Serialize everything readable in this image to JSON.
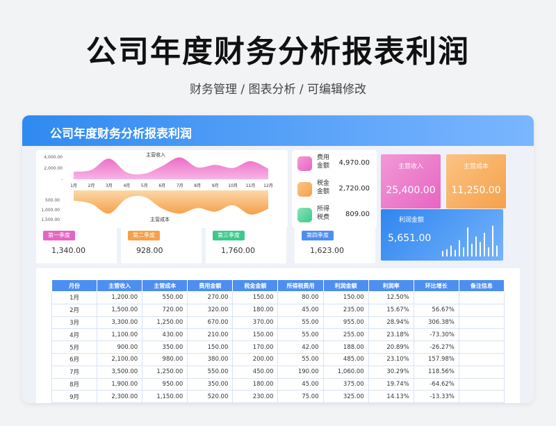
{
  "header": {
    "title": "公司年度财务分析报表利润",
    "subtitle": "财务管理 / 图表分析 /  可编辑修改"
  },
  "card": {
    "title": "公司年度财务分析报表利润"
  },
  "colors": {
    "income": "#e765c2",
    "cost": "#f5a14a",
    "header_blue": "#2f8af0",
    "table_header": "#4d8ff0"
  },
  "chart_data": {
    "type": "area",
    "top_chart": {
      "title": "主营收入",
      "y_ticks": [
        "4,000.00",
        "2,000.00",
        "-"
      ],
      "ylim": [
        0,
        4000
      ],
      "x": [
        "1月",
        "2月",
        "3月",
        "4月",
        "5月",
        "6月",
        "7月",
        "8月",
        "9月",
        "10月",
        "11月",
        "12月"
      ],
      "series": [
        {
          "name": "主营收入",
          "values": [
            1200,
            1500,
            3300,
            1100,
            900,
            2100,
            3500,
            1900,
            2300,
            1800,
            2900,
            1700
          ]
        }
      ]
    },
    "bottom_chart": {
      "title": "主营成本",
      "y_ticks": [
        "500.00",
        "1,000.00",
        "1,500.00"
      ],
      "ylim": [
        0,
        1500
      ],
      "series": [
        {
          "name": "主营成本",
          "values": [
            550,
            720,
            1250,
            430,
            350,
            980,
            1250,
            950,
            1150,
            800,
            1300,
            1000
          ]
        }
      ]
    }
  },
  "stats": [
    {
      "label": "费用金额",
      "value": "4,970.00",
      "color": "#e765c2",
      "icon": "expense-icon"
    },
    {
      "label": "税金金额",
      "value": "2,720.00",
      "color": "#f5a14a",
      "icon": "tax-icon"
    },
    {
      "label": "所得税费",
      "value": "809.00",
      "color": "#3ec98c",
      "icon": "income-tax-icon"
    }
  ],
  "kpis": {
    "income": {
      "label": "主营收入",
      "value": "25,400.00"
    },
    "cost": {
      "label": "主营成本",
      "value": "11,250.00"
    },
    "profit": {
      "label": "利润金额",
      "value": "5,651.00"
    }
  },
  "profit_bars": [
    0.15,
    0.2,
    0.3,
    0.18,
    0.45,
    0.25,
    0.8,
    0.35,
    0.55,
    0.4,
    0.65,
    0.25,
    0.85,
    0.3
  ],
  "quarters": [
    {
      "label": "第一季度",
      "value": "1,340.00",
      "color": "#e765c2"
    },
    {
      "label": "第二季度",
      "value": "928.00",
      "color": "#f5a14a"
    },
    {
      "label": "第三季度",
      "value": "1,760.00",
      "color": "#3ec98c"
    },
    {
      "label": "第四季度",
      "value": "1,623.00",
      "color": "#4d8ff0"
    }
  ],
  "table": {
    "headers": [
      "月份",
      "主营收入",
      "主营成本",
      "费用金额",
      "税金金额",
      "所得税费用",
      "利润金额",
      "利润率",
      "环比增长",
      "备注信息"
    ],
    "rows": [
      [
        "1月",
        "1,200.00",
        "550.00",
        "270.00",
        "150.00",
        "80.00",
        "150.00",
        "12.50%",
        "",
        ""
      ],
      [
        "2月",
        "1,500.00",
        "720.00",
        "320.00",
        "180.00",
        "45.00",
        "235.00",
        "15.67%",
        "56.67%",
        ""
      ],
      [
        "3月",
        "3,300.00",
        "1,250.00",
        "670.00",
        "370.00",
        "55.00",
        "955.00",
        "28.94%",
        "306.38%",
        ""
      ],
      [
        "4月",
        "1,100.00",
        "430.00",
        "210.00",
        "150.00",
        "55.00",
        "255.00",
        "23.18%",
        "-73.30%",
        ""
      ],
      [
        "5月",
        "900.00",
        "350.00",
        "150.00",
        "170.00",
        "42.00",
        "188.00",
        "20.89%",
        "-26.27%",
        ""
      ],
      [
        "6月",
        "2,100.00",
        "980.00",
        "380.00",
        "200.00",
        "55.00",
        "485.00",
        "23.10%",
        "157.98%",
        ""
      ],
      [
        "7月",
        "3,500.00",
        "1,250.00",
        "550.00",
        "450.00",
        "190.00",
        "1,060.00",
        "30.29%",
        "118.56%",
        ""
      ],
      [
        "8月",
        "1,900.00",
        "950.00",
        "350.00",
        "180.00",
        "45.00",
        "375.00",
        "19.74%",
        "-64.62%",
        ""
      ],
      [
        "9月",
        "2,300.00",
        "1,150.00",
        "520.00",
        "230.00",
        "75.00",
        "325.00",
        "14.13%",
        "-13.33%",
        ""
      ]
    ]
  }
}
